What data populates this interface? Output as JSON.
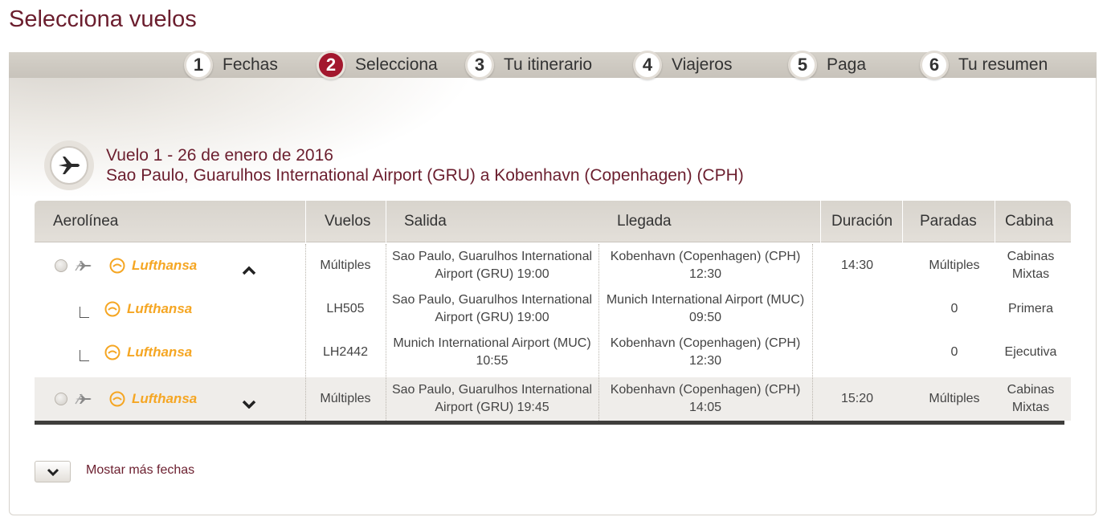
{
  "page": {
    "title": "Selecciona vuelos"
  },
  "steps": [
    {
      "num": "1",
      "label": "Fechas",
      "active": false
    },
    {
      "num": "2",
      "label": "Selecciona",
      "active": true
    },
    {
      "num": "3",
      "label": "Tu itinerario",
      "active": false
    },
    {
      "num": "4",
      "label": "Viajeros",
      "active": false
    },
    {
      "num": "5",
      "label": "Paga",
      "active": false
    },
    {
      "num": "6",
      "label": "Tu resumen",
      "active": false
    }
  ],
  "flight": {
    "title": "Vuelo 1 - 26 de enero de 2016",
    "route": "Sao Paulo, Guarulhos International Airport (GRU) a Kobenhavn (Copenhagen) (CPH)",
    "icon": "airplane-icon"
  },
  "table": {
    "headers": {
      "airline": "Aerolínea",
      "flights": "Vuelos",
      "departure": "Salida",
      "arrival": "Llegada",
      "duration": "Duración",
      "stops": "Paradas",
      "cabin": "Cabina"
    },
    "rows": [
      {
        "airline": "Lufthansa",
        "flights": "Múltiples",
        "dep1": "Sao Paulo, Guarulhos International",
        "dep2": "Airport (GRU) 19:00",
        "arr1": "Kobenhavn (Copenhagen) (CPH)",
        "arr2": "12:30",
        "duration": "14:30",
        "stops": "Múltiples",
        "cabin1": "Cabinas",
        "cabin2": "Mixtas",
        "expanded": true
      },
      {
        "airline": "Lufthansa",
        "flights": "LH505",
        "dep1": "Sao Paulo, Guarulhos International",
        "dep2": "Airport (GRU) 19:00",
        "arr1": "Munich International Airport (MUC)",
        "arr2": "09:50",
        "duration": "",
        "stops": "0",
        "cabin1": "Primera",
        "cabin2": ""
      },
      {
        "airline": "Lufthansa",
        "flights": "LH2442",
        "dep1": "Munich International Airport (MUC)",
        "dep2": "10:55",
        "arr1": "Kobenhavn (Copenhagen) (CPH)",
        "arr2": "12:30",
        "duration": "",
        "stops": "0",
        "cabin1": "Ejecutiva",
        "cabin2": ""
      },
      {
        "airline": "Lufthansa",
        "flights": "Múltiples",
        "dep1": "Sao Paulo, Guarulhos International",
        "dep2": "Airport (GRU) 19:45",
        "arr1": "Kobenhavn (Copenhagen) (CPH)",
        "arr2": "14:05",
        "duration": "15:20",
        "stops": "Múltiples",
        "cabin1": "Cabinas",
        "cabin2": "Mixtas",
        "expanded": false
      }
    ]
  },
  "more_dates": {
    "label": "Mostar más fechas"
  },
  "colors": {
    "brand": "#6b1e2e",
    "active_step": "#a3182e",
    "lufthansa": "#f5a623"
  }
}
